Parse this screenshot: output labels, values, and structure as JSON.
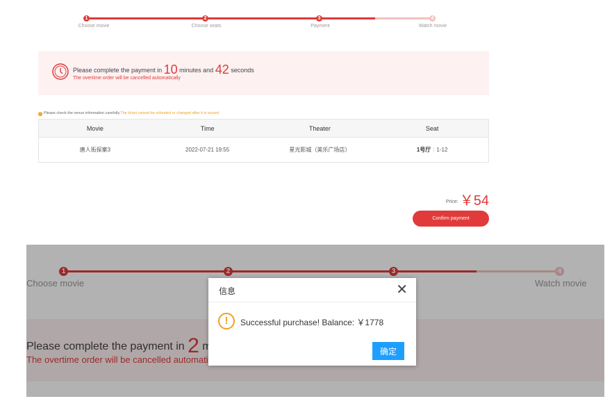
{
  "steps": [
    {
      "num": "1",
      "label": "Choose movie"
    },
    {
      "num": "2",
      "label": "Choose seats"
    },
    {
      "num": "3",
      "label": "Payment"
    },
    {
      "num": "4",
      "label": "Watch movie"
    }
  ],
  "timer": {
    "prefix": "Please complete the payment in",
    "minutes": "10",
    "mid": "minutes and",
    "seconds": "42",
    "suffix": "seconds",
    "warning": "The overtime order will be cancelled automatically"
  },
  "notice": {
    "main": "Please check the venue information carefully.",
    "highlight": "The ticket cannot be refunded or changed after it is issued"
  },
  "table": {
    "headers": [
      "Movie",
      "Time",
      "Theater",
      "Seat"
    ],
    "row": {
      "movie": "唐人街探案3",
      "time": "2022-07-21 19:55",
      "theater": "星光影城（美乐广场店）",
      "hall": "1号厅",
      "seat": "1-12"
    }
  },
  "price": {
    "label": "Price:",
    "amount": "￥54"
  },
  "confirm_button": "Confirm payment",
  "lower": {
    "timer_prefix": "Please complete the payment in",
    "minutes": "2",
    "timer_cut": "minut",
    "warning_visible": "The overtime order will be cancelled automaticall"
  },
  "modal": {
    "title": "信息",
    "close": "✕",
    "icon": "!",
    "message": "Successful purchase!  Balance: ￥1778",
    "ok": "确定"
  },
  "colors": {
    "accent": "#e03a3a",
    "accent_light": "#f3c1c1",
    "warning": "#f0a020",
    "button_blue": "#1e9fff"
  }
}
